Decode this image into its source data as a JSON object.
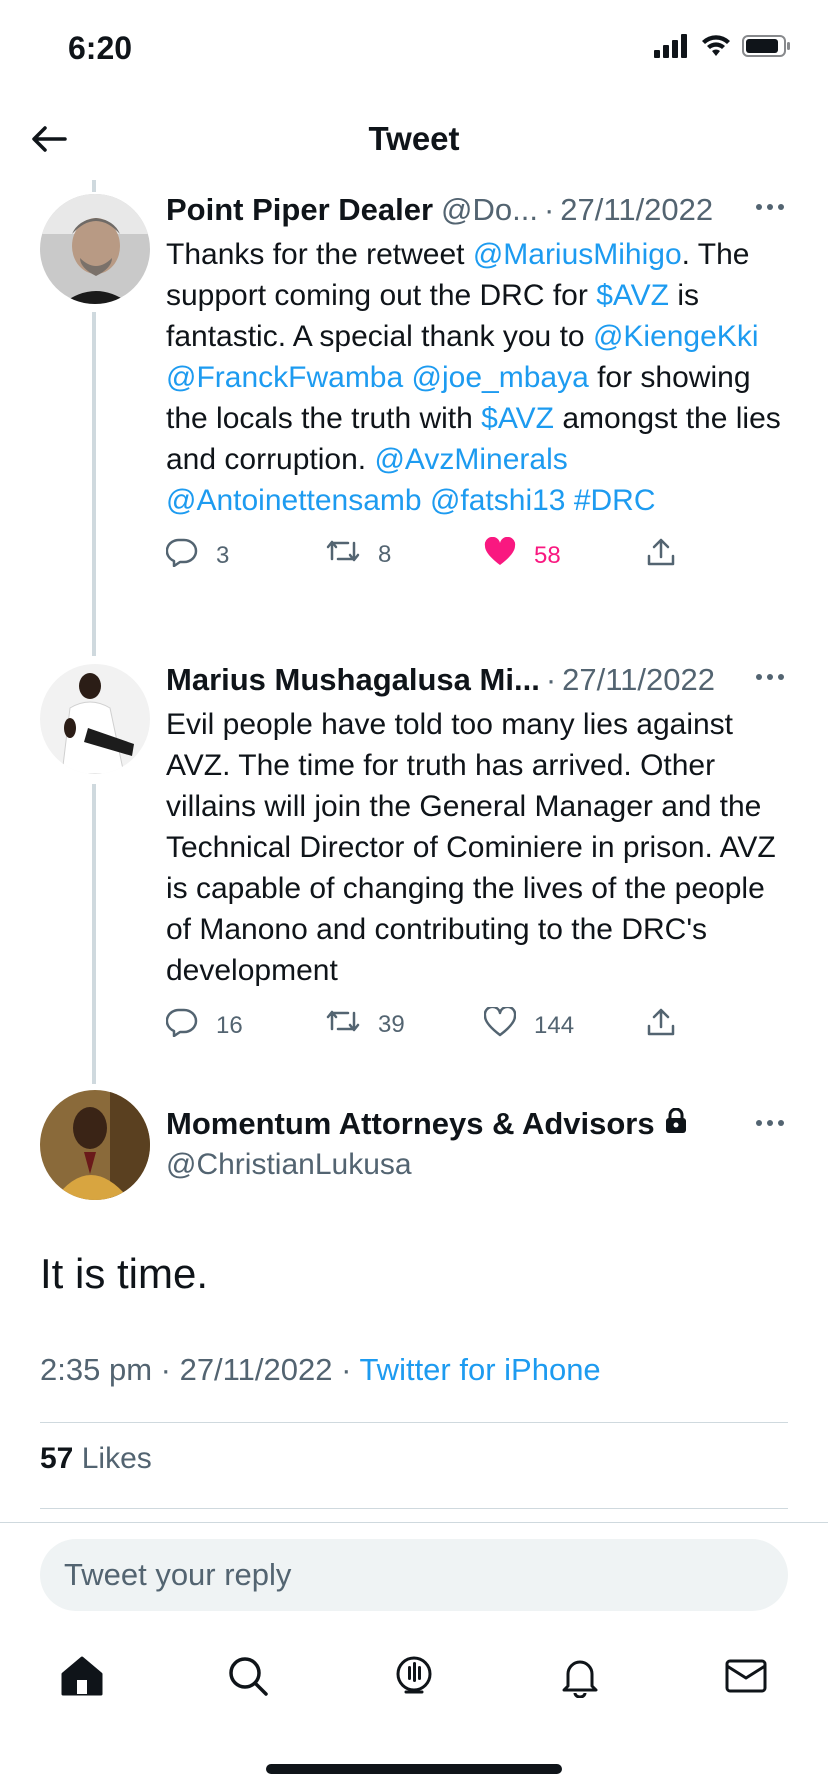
{
  "status_bar": {
    "time": "6:20"
  },
  "header": {
    "title": "Tweet"
  },
  "thread": [
    {
      "name": "Point Piper Dealer",
      "handle": "@Do...",
      "date": "27/11/2022",
      "text": [
        {
          "t": "Thanks for the retweet "
        },
        {
          "t": "@MariusMihigo",
          "link": true
        },
        {
          "t": ". The support coming out the DRC for "
        },
        {
          "t": "$AVZ",
          "link": true
        },
        {
          "t": " is fantastic. A special thank you to "
        },
        {
          "t": "@KiengeKki",
          "link": true
        },
        {
          "t": " "
        },
        {
          "t": "@FranckFwamba",
          "link": true
        },
        {
          "t": " "
        },
        {
          "t": "@joe_mbaya",
          "link": true
        },
        {
          "t": " for showing the locals the truth with "
        },
        {
          "t": "$AVZ",
          "link": true
        },
        {
          "t": " amongst the lies and corruption. "
        },
        {
          "t": "@AvzMinerals",
          "link": true
        },
        {
          "t": " "
        },
        {
          "t": "@Antoinettensamb",
          "link": true
        },
        {
          "t": " "
        },
        {
          "t": "@fatshi13",
          "link": true
        },
        {
          "t": " "
        },
        {
          "t": "#DRC",
          "link": true
        }
      ],
      "replies": "3",
      "retweets": "8",
      "likes": "58",
      "liked": true
    },
    {
      "name": "Marius Mushagalusa Mi...",
      "handle": "",
      "date": "27/11/2022",
      "text": [
        {
          "t": "Evil people have told too many lies against AVZ. The time for truth has arrived. Other villains will join the General Manager and the Technical Director of Cominiere in prison. AVZ is  capable of changing the lives of the people of Manono and contributing to the DRC's development"
        }
      ],
      "replies": "16",
      "retweets": "39",
      "likes": "144",
      "liked": false
    }
  ],
  "main_tweet": {
    "name": "Momentum Attorneys & Advisors",
    "handle": "@ChristianLukusa",
    "text": "It is time.",
    "time": "2:35 pm",
    "date": "27/11/2022",
    "source": "Twitter for iPhone",
    "likes_count": "57",
    "likes_label": "Likes"
  },
  "reply": {
    "placeholder": "Tweet your reply"
  },
  "colors": {
    "accent": "#1d9bf0",
    "like": "#f91880",
    "muted": "#536471"
  }
}
